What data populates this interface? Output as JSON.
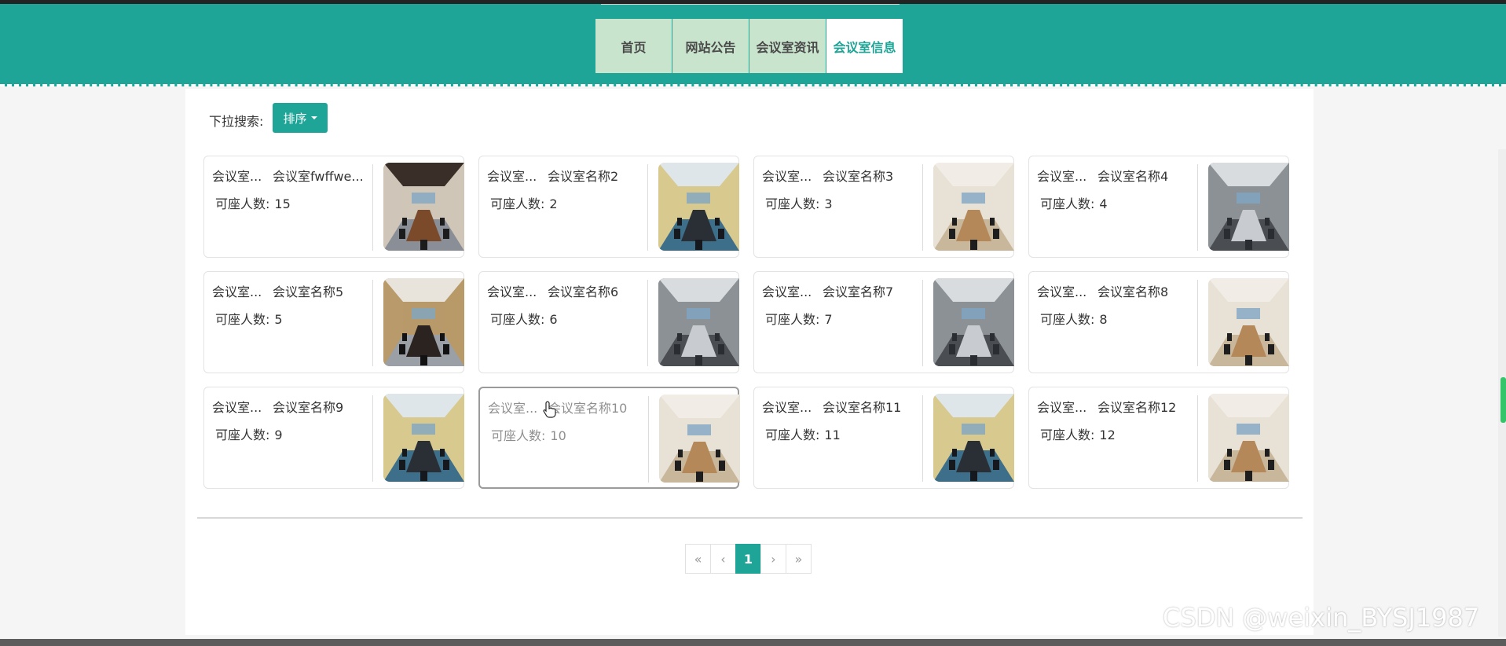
{
  "nav": {
    "items": [
      {
        "label": "首页",
        "active": false
      },
      {
        "label": "网站公告",
        "active": false
      },
      {
        "label": "会议室资讯",
        "active": false
      },
      {
        "label": "会议室信息",
        "active": true
      }
    ]
  },
  "search": {
    "label": "下拉搜索:",
    "sort_label": "排序"
  },
  "seats_label": "可座人数:",
  "cards": [
    {
      "category": "会议室...",
      "name": "会议室fwffwe...",
      "seats": "15",
      "image": "conference-room-wood-ceiling"
    },
    {
      "category": "会议室...",
      "name": "会议室名称2",
      "seats": "2",
      "image": "conference-room-blue-carpet"
    },
    {
      "category": "会议室...",
      "name": "会议室名称3",
      "seats": "3",
      "image": "conference-room-long-table"
    },
    {
      "category": "会议室...",
      "name": "会议室名称4",
      "seats": "4",
      "image": "conference-room-gray"
    },
    {
      "category": "会议室...",
      "name": "会议室名称5",
      "seats": "5",
      "image": "conference-room-dark-table"
    },
    {
      "category": "会议室...",
      "name": "会议室名称6",
      "seats": "6",
      "image": "conference-room-gray"
    },
    {
      "category": "会议室...",
      "name": "会议室名称7",
      "seats": "7",
      "image": "conference-room-gray"
    },
    {
      "category": "会议室...",
      "name": "会议室名称8",
      "seats": "8",
      "image": "conference-room-long-table"
    },
    {
      "category": "会议室...",
      "name": "会议室名称9",
      "seats": "9",
      "image": "conference-room-blue-carpet"
    },
    {
      "category": "会议室...",
      "name": "会议室名称10",
      "seats": "10",
      "image": "conference-room-long-table",
      "hovered": true
    },
    {
      "category": "会议室...",
      "name": "会议室名称11",
      "seats": "11",
      "image": "conference-room-blue-carpet"
    },
    {
      "category": "会议室...",
      "name": "会议室名称12",
      "seats": "12",
      "image": "conference-room-long-table"
    }
  ],
  "pagination": {
    "first": "«",
    "prev": "‹",
    "current": "1",
    "next": "›",
    "last": "»"
  },
  "watermark": "CSDN @weixin_BYSJ1987",
  "colors": {
    "accent": "#1ea597",
    "nav_bg": "#c9e4cd",
    "text": "#333333"
  }
}
